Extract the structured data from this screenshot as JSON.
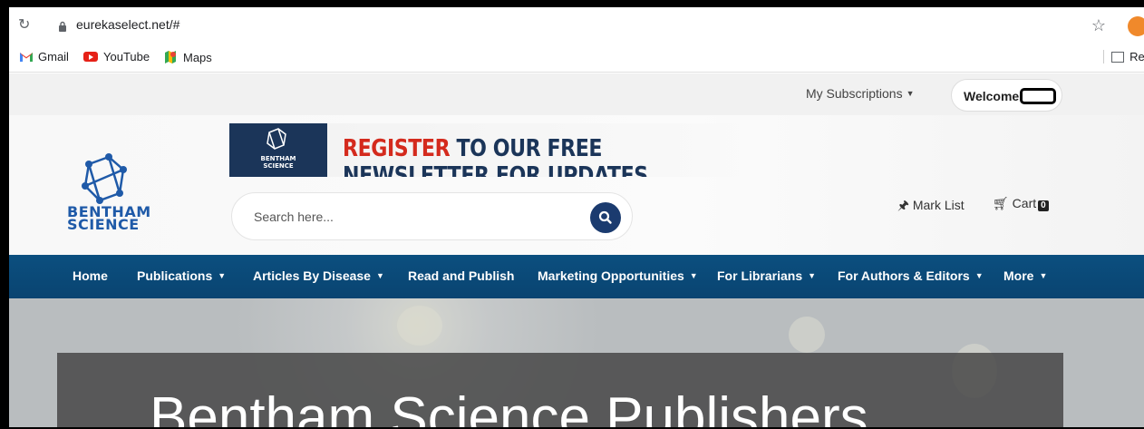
{
  "browser": {
    "url": "eurekaselect.net/#",
    "bookmarks": [
      {
        "label": "Gmail"
      },
      {
        "label": "YouTube"
      },
      {
        "label": "Maps"
      }
    ],
    "reading_list_label": "Rea"
  },
  "topbar": {
    "subscriptions_label": "My Subscriptions",
    "welcome_label": "Welcome"
  },
  "header": {
    "logo_line1": "BENTHAM",
    "logo_line2": "SCIENCE",
    "banner": {
      "logo_line1": "BENTHAM",
      "logo_line2": "SCIENCE",
      "highlight": "REGISTER",
      "rest": " TO OUR FREE NEWSLETTER FOR UPDATES"
    },
    "search_placeholder": "Search here...",
    "mark_list_label": "Mark List",
    "cart_label": "Cart",
    "cart_count": "0"
  },
  "nav": {
    "items": [
      {
        "label": "Home",
        "dropdown": false
      },
      {
        "label": "Publications",
        "dropdown": true
      },
      {
        "label": "Articles By Disease",
        "dropdown": true
      },
      {
        "label": "Read and Publish",
        "dropdown": false
      },
      {
        "label": "Marketing Opportunities",
        "dropdown": true
      },
      {
        "label": "For Librarians",
        "dropdown": true
      },
      {
        "label": "For Authors & Editors",
        "dropdown": true
      },
      {
        "label": "More",
        "dropdown": true
      }
    ]
  },
  "hero": {
    "title": "Bentham Science Publishers"
  },
  "colors": {
    "nav_bg": "#0b4f7f",
    "brand_blue": "#1f5aa8",
    "banner_red": "#d42a1d",
    "search_button": "#1b3b6f"
  }
}
